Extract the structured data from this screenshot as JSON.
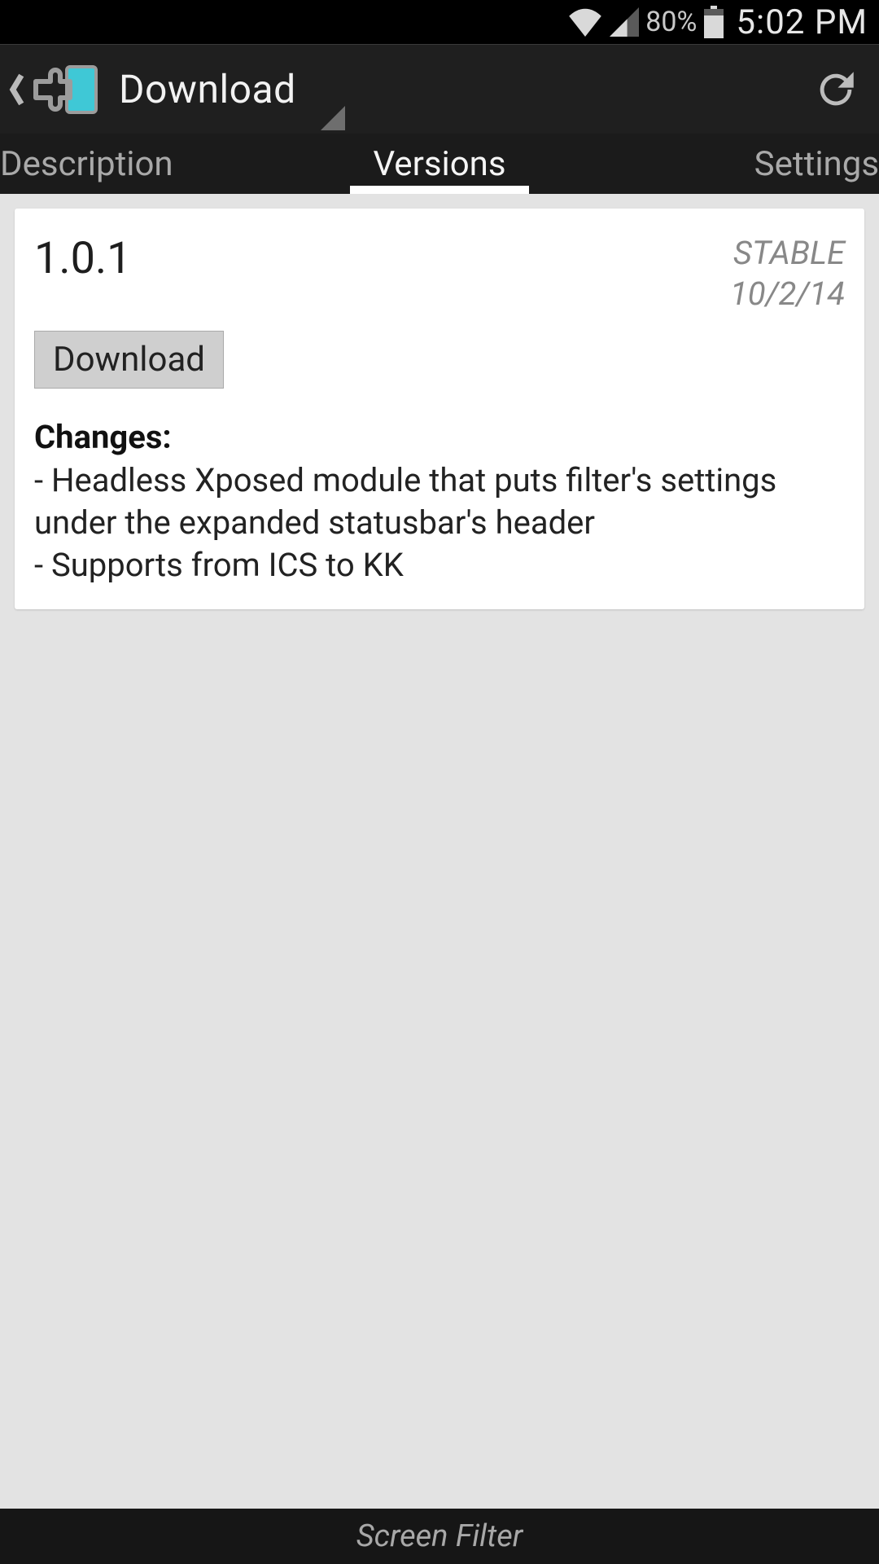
{
  "statusbar": {
    "battery_pct": "80%",
    "clock": "5:02 PM"
  },
  "actionbar": {
    "title": "Download"
  },
  "tabs": {
    "description": "Description",
    "versions": "Versions",
    "settings": "Settings",
    "active": "versions"
  },
  "card": {
    "version": "1.0.1",
    "stability": "STABLE",
    "date": "10/2/14",
    "download_label": "Download",
    "changes_heading": "Changes:",
    "changes_body": "- Headless Xposed module that puts filter's settings under the expanded statusbar's header\n- Supports from ICS to KK"
  },
  "footer": {
    "label": "Screen Filter"
  }
}
